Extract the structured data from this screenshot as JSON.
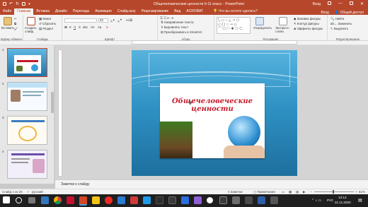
{
  "titlebar": {
    "title": "Общечеловеческие ценности 9-11 класс - PowerPoint",
    "sign_in": "Вход"
  },
  "tabs": [
    {
      "label": "Файл"
    },
    {
      "label": "Главная"
    },
    {
      "label": "Вставка"
    },
    {
      "label": "Дизайн"
    },
    {
      "label": "Переходы"
    },
    {
      "label": "Анимация"
    },
    {
      "label": "Слайд-шоу"
    },
    {
      "label": "Рецензирование"
    },
    {
      "label": "Вид"
    },
    {
      "label": "ACROBAT"
    }
  ],
  "tell_me": "Что вы хотите сделать?",
  "share": "Общий доступ",
  "ribbon": {
    "paste": "Вставить",
    "create_slide": "Создать слайд",
    "layout": "Макет",
    "reset": "Сбросить",
    "section": "Раздел",
    "font_size": "32",
    "text_direction": "Направление текста",
    "align_text": "Выровнять текст",
    "smartart": "Преобразовать в SmartArt",
    "arrange": "Упорядочить",
    "quick_styles": "Экспресс-стили",
    "shape_fill": "Заливка фигуры",
    "shape_outline": "Контур фигуры",
    "shape_effects": "Эффекты фигуры",
    "find": "Найти",
    "replace": "Заменить",
    "select": "Выделить",
    "groups": {
      "clipboard": "Буфер обмена",
      "slides": "Слайды",
      "font": "Шрифт",
      "paragraph": "Абзац",
      "drawing": "Рисование",
      "editing": "Редактирование"
    }
  },
  "thumbnails": [
    {
      "num": "1"
    },
    {
      "num": "2"
    },
    {
      "num": "3"
    },
    {
      "num": "4"
    }
  ],
  "slide": {
    "title": "Общечеловеческие ценности"
  },
  "notes_placeholder": "Заметки к слайду",
  "statusbar": {
    "slide_info": "Слайд 1 из 25",
    "language": "русский",
    "notes_btn": "Заметки",
    "comments_btn": "Примечания",
    "zoom": "61%"
  },
  "taskbar": {
    "time": "13:12",
    "date": "21.11.2020",
    "lang": "РУС"
  },
  "colors": {
    "accent": "#b7472a",
    "slide_title": "#c51a2a"
  }
}
